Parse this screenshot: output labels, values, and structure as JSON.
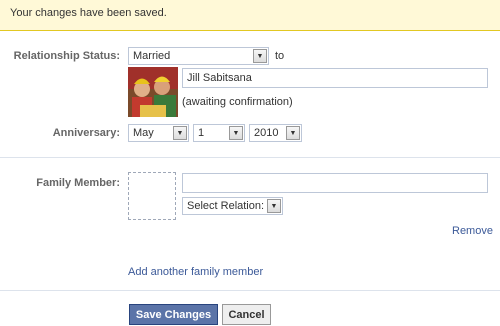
{
  "banner": {
    "message": "Your changes have been saved."
  },
  "relationship": {
    "label": "Relationship Status:",
    "status": "Married",
    "to_label": "to",
    "partner_name": "Jill Sabitsana",
    "awaiting": "(awaiting confirmation)"
  },
  "anniversary": {
    "label": "Anniversary:",
    "month": "May",
    "day": "1",
    "year": "2010"
  },
  "family": {
    "label": "Family Member:",
    "name_value": "",
    "relation": "Select Relation:",
    "remove": "Remove",
    "add_another": "Add another family member"
  },
  "buttons": {
    "save": "Save Changes",
    "cancel": "Cancel"
  },
  "colors": {
    "link": "#3b5998",
    "primary_button": "#5b74a8",
    "banner_bg": "#fff9d7",
    "banner_border": "#e2c822"
  }
}
